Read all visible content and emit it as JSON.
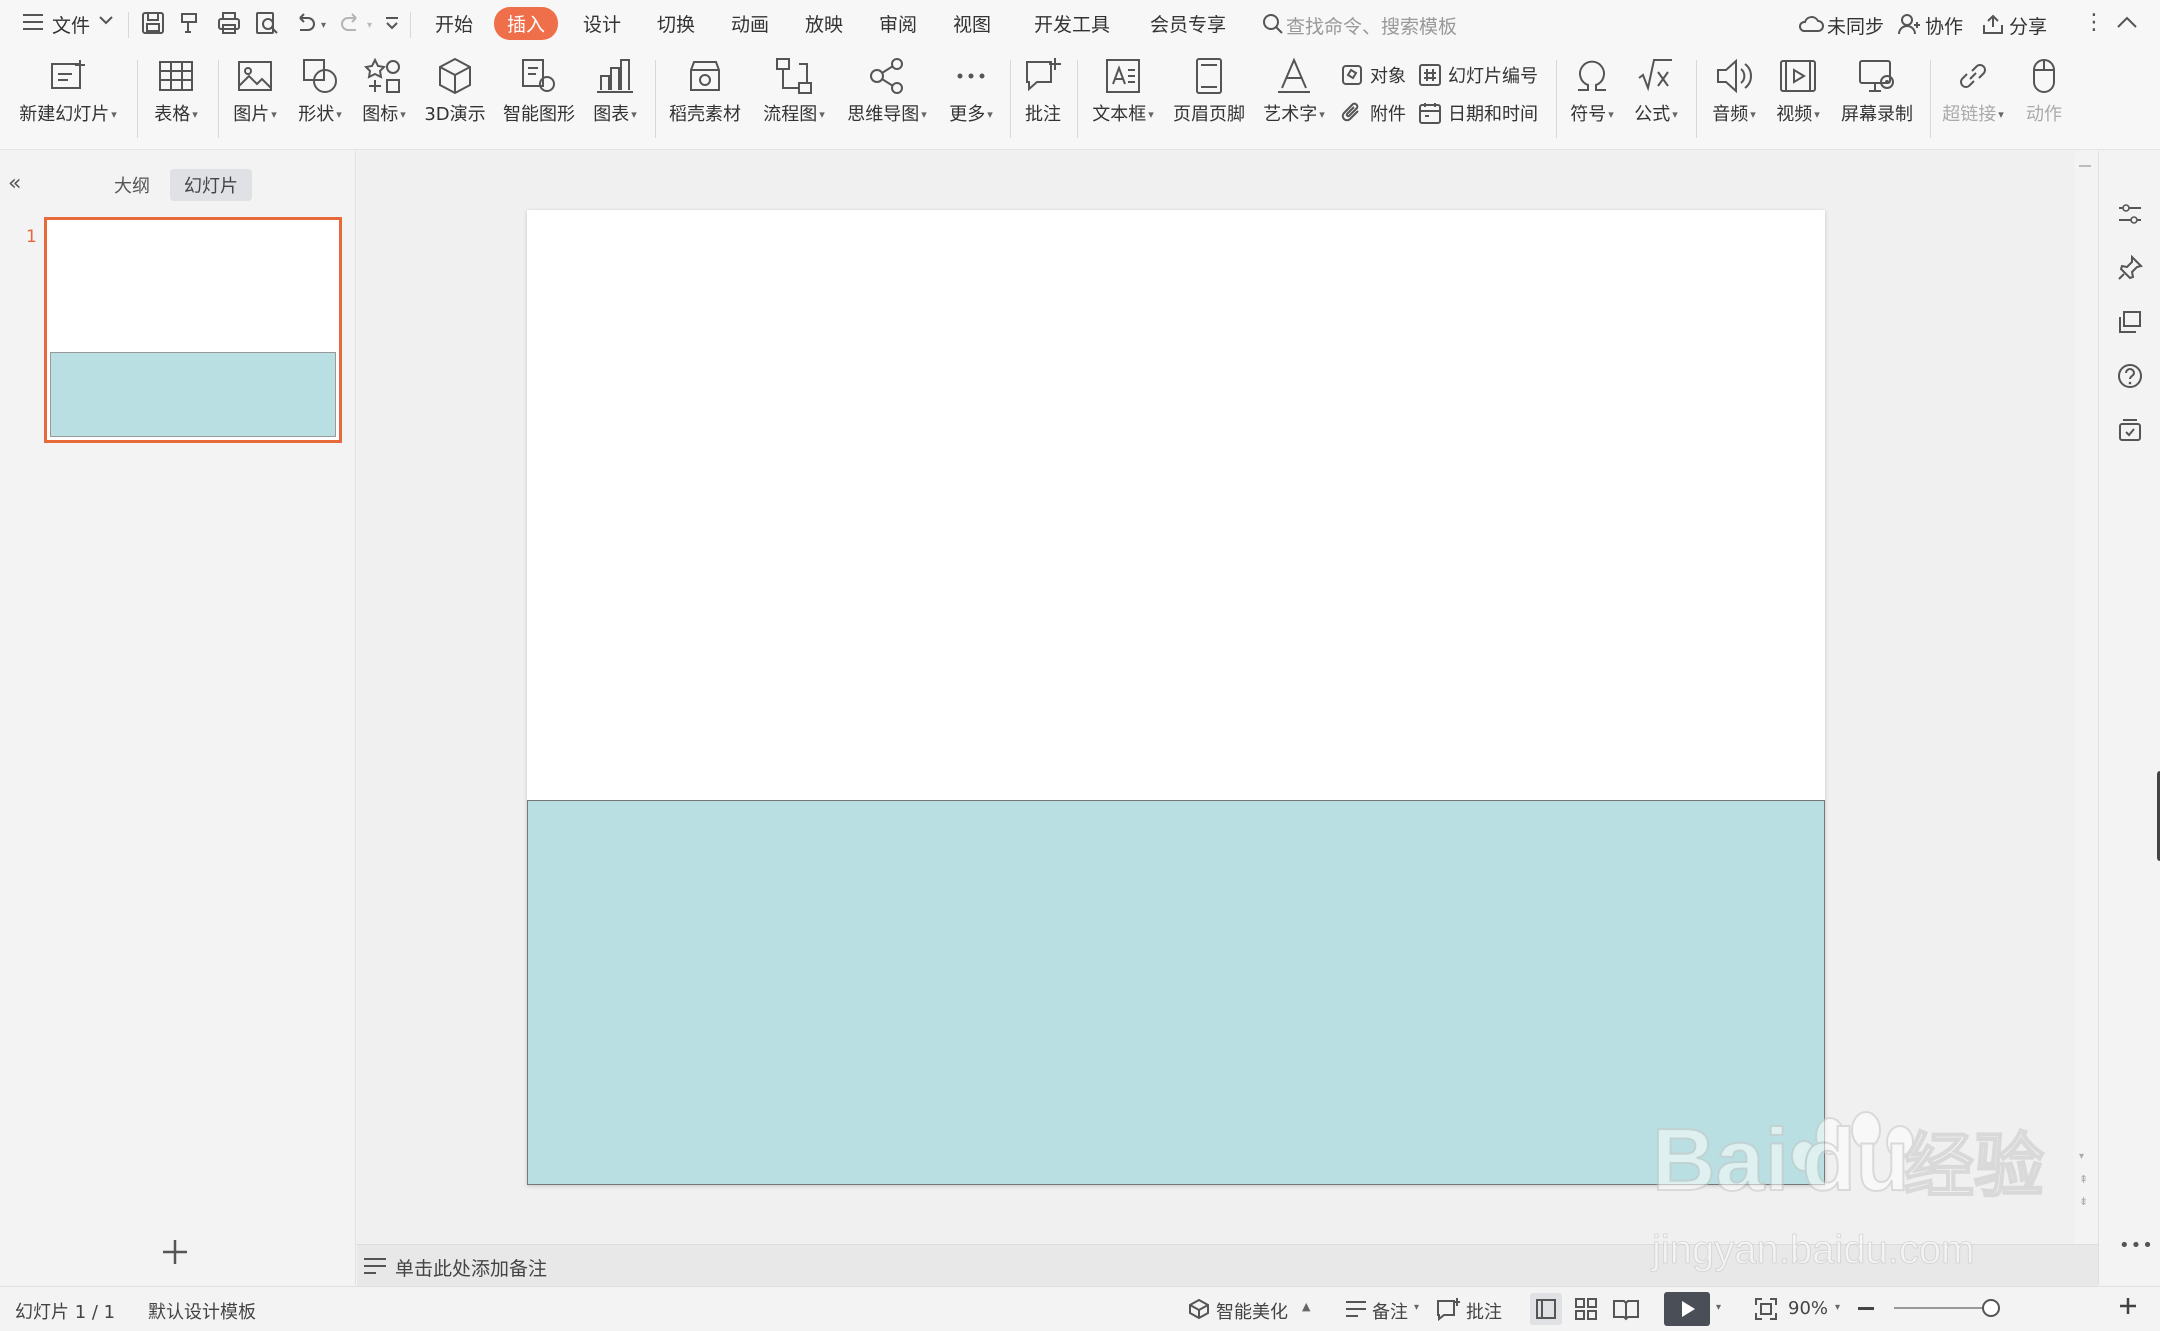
{
  "titlebar": {
    "file_menu": "文件",
    "tabs": [
      "开始",
      "插入",
      "设计",
      "切换",
      "动画",
      "放映",
      "审阅",
      "视图",
      "开发工具",
      "会员专享"
    ],
    "active_tab": "插入",
    "search_placeholder": "查找命令、搜索模板",
    "sync": "未同步",
    "collab": "协作",
    "share": "分享"
  },
  "ribbon": {
    "new_slide": "新建幻灯片",
    "table": "表格",
    "picture": "图片",
    "shape": "形状",
    "icon": "图标",
    "three_d": "3D演示",
    "smartart": "智能图形",
    "chart": "图表",
    "material": "稻壳素材",
    "flowchart": "流程图",
    "mindmap": "思维导图",
    "more": "更多",
    "comment": "批注",
    "textbox": "文本框",
    "header_footer": "页眉页脚",
    "wordart": "艺术字",
    "object": "对象",
    "attachment": "附件",
    "slide_number": "幻灯片编号",
    "datetime": "日期和时间",
    "symbol": "符号",
    "formula": "公式",
    "audio": "音频",
    "video": "视频",
    "screen_record": "屏幕录制",
    "hyperlink": "超链接",
    "action": "动作"
  },
  "leftpanel": {
    "tab_outline": "大纲",
    "tab_slides": "幻灯片",
    "slide_number": "1"
  },
  "colors": {
    "accent": "#f06f4b",
    "slide_shape_fill": "#b9dfe2",
    "slide_border": "#777777"
  },
  "notes": {
    "placeholder": "单击此处添加备注"
  },
  "statusbar": {
    "slide_count": "幻灯片 1 / 1",
    "template": "默认设计模板",
    "smart_beautify": "智能美化",
    "notes": "备注",
    "comments": "批注",
    "zoom": "90%"
  },
  "watermark": {
    "brand": "Baidu经验",
    "url": "jingyan.baidu.com"
  }
}
